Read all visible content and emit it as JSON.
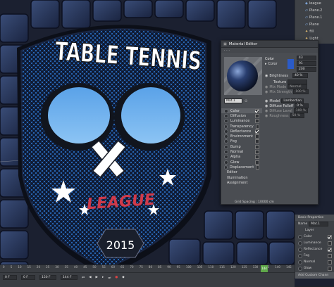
{
  "scene": {
    "title_line": "TABLE TENNIS",
    "league": "LEAGUE",
    "year": "2015"
  },
  "material_editor": {
    "title": "Material Editor",
    "material_name": "Mat.1",
    "section": "Color",
    "color_label": "Color",
    "rgb": [
      "43",
      "91",
      "200"
    ],
    "swatch_color": "#2b5bc8",
    "brightness_label": "Brightness",
    "brightness_value": "40 %",
    "texture_label": "Texture",
    "mix_mode_label": "Mix Mode",
    "mix_mode_value": "Normal",
    "mix_strength_label": "Mix Strength",
    "mix_strength_value": "100 %",
    "model_label": "Model",
    "model_value": "Lambertian",
    "diffuse_falloff_label": "Diffuse Falloff",
    "diffuse_falloff_value": "0 %",
    "diffuse_level_label": "Diffuse Level",
    "diffuse_level_value": "100 %",
    "roughness_label": "Roughness",
    "roughness_value": "50 %",
    "channels": [
      {
        "label": "Color",
        "checked": true
      },
      {
        "label": "Diffusion",
        "checked": false
      },
      {
        "label": "Luminance",
        "checked": false
      },
      {
        "label": "Transparency",
        "checked": false
      },
      {
        "label": "Reflectance",
        "checked": true
      },
      {
        "label": "Environment",
        "checked": false
      },
      {
        "label": "Fog",
        "checked": false
      },
      {
        "label": "Bump",
        "checked": false
      },
      {
        "label": "Normal",
        "checked": false
      },
      {
        "label": "Alpha",
        "checked": false
      },
      {
        "label": "Glow",
        "checked": false
      },
      {
        "label": "Displacement",
        "checked": false
      }
    ],
    "editor_links": [
      "Editor",
      "Illumination",
      "Assignment"
    ]
  },
  "object_manager": {
    "items": [
      "league",
      "Plane.2",
      "Plane.1",
      "Plane",
      "fill",
      "Light",
      "Light"
    ]
  },
  "attributes": {
    "header": "Basic Properties",
    "name_label": "Name",
    "name_value": "Mat.1",
    "layer_label": "Layer",
    "rows": [
      {
        "label": "Color",
        "checked": true
      },
      {
        "label": "Luminance",
        "checked": false
      },
      {
        "label": "Reflectance",
        "checked": true
      },
      {
        "label": "Fog",
        "checked": false
      },
      {
        "label": "Normal",
        "checked": false
      },
      {
        "label": "Glow",
        "checked": false
      }
    ],
    "footer_button": "Add Custom Chann"
  },
  "status": {
    "grid_spacing": "Grid Spacing : 10000 cm"
  },
  "timeline": {
    "ticks": [
      "0",
      "5",
      "10",
      "15",
      "20",
      "25",
      "30",
      "35",
      "40",
      "45",
      "50",
      "55",
      "60",
      "65",
      "70",
      "75",
      "80",
      "85",
      "90",
      "95",
      "100",
      "105",
      "110",
      "115",
      "120",
      "125",
      "130",
      "135",
      "140",
      "145"
    ],
    "current_frame": "144",
    "start_field": "0 F",
    "start_field2": "0 F",
    "end_field": "150 F",
    "end_field2": "144 F"
  },
  "colors": {
    "shield_blue": "#2a64b4",
    "league_red": "#d03a4a",
    "swatch": "#2b5bc8"
  }
}
